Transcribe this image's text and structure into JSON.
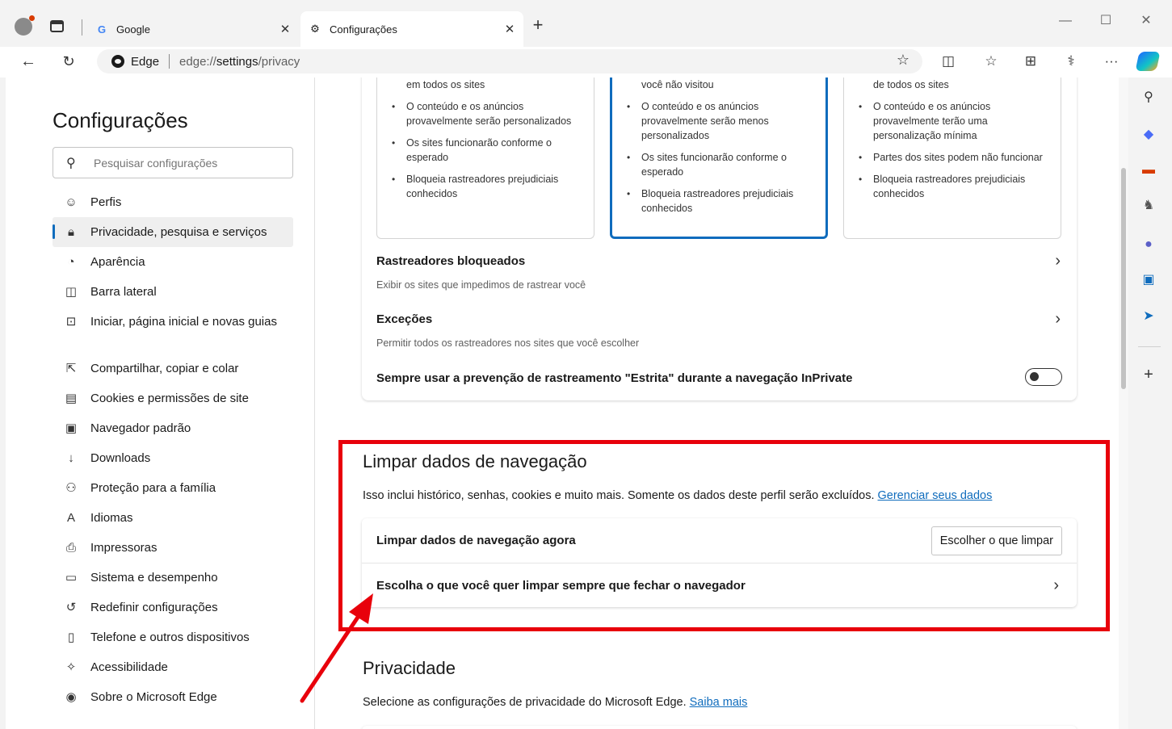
{
  "browser": {
    "tabs": [
      {
        "title": "Google",
        "icon": "google-icon"
      },
      {
        "title": "Configurações",
        "icon": "gear-icon"
      }
    ],
    "omnibox": {
      "brand": "Edge",
      "url_prefix": "edge://",
      "url_main": "settings",
      "url_suffix": "/privacy"
    }
  },
  "sidebar": {
    "title": "Configurações",
    "search_placeholder": "Pesquisar configurações",
    "items": [
      {
        "label": "Perfis",
        "icon": "profile-icon"
      },
      {
        "label": "Privacidade, pesquisa e serviços",
        "icon": "lock-icon",
        "active": true
      },
      {
        "label": "Aparência",
        "icon": "palette-icon"
      },
      {
        "label": "Barra lateral",
        "icon": "sidebar-icon"
      },
      {
        "label": "Iniciar, página inicial e novas guias",
        "icon": "home-icon"
      },
      {
        "label": "Compartilhar, copiar e colar",
        "icon": "share-icon"
      },
      {
        "label": "Cookies e permissões de site",
        "icon": "cookies-icon"
      },
      {
        "label": "Navegador padrão",
        "icon": "browser-icon"
      },
      {
        "label": "Downloads",
        "icon": "download-icon"
      },
      {
        "label": "Proteção para a família",
        "icon": "family-icon"
      },
      {
        "label": "Idiomas",
        "icon": "language-icon"
      },
      {
        "label": "Impressoras",
        "icon": "printer-icon"
      },
      {
        "label": "Sistema e desempenho",
        "icon": "laptop-icon"
      },
      {
        "label": "Redefinir configurações",
        "icon": "reset-icon"
      },
      {
        "label": "Telefone e outros dispositivos",
        "icon": "phone-icon"
      },
      {
        "label": "Acessibilidade",
        "icon": "accessibility-icon"
      },
      {
        "label": "Sobre o Microsoft Edge",
        "icon": "edge-icon"
      }
    ]
  },
  "tracking": {
    "cards": [
      {
        "items": [
          "em todos os sites",
          "O conteúdo e os anúncios provavelmente serão personalizados",
          "Os sites funcionarão conforme o esperado",
          "Bloqueia rastreadores prejudiciais conhecidos"
        ]
      },
      {
        "items": [
          "você não visitou",
          "O conteúdo e os anúncios provavelmente serão menos personalizados",
          "Os sites funcionarão conforme o esperado",
          "Bloqueia rastreadores prejudiciais conhecidos"
        ],
        "selected": true
      },
      {
        "items": [
          "de todos os sites",
          "O conteúdo e os anúncios provavelmente terão uma personalização mínima",
          "Partes dos sites podem não funcionar",
          "Bloqueia rastreadores prejudiciais conhecidos"
        ]
      }
    ],
    "blocked_title": "Rastreadores bloqueados",
    "blocked_sub": "Exibir os sites que impedimos de rastrear você",
    "exceptions_title": "Exceções",
    "exceptions_sub": "Permitir todos os rastreadores nos sites que você escolher",
    "strict_label": "Sempre usar a prevenção de rastreamento \"Estrita\" durante a navegação InPrivate",
    "strict_on": false
  },
  "clear_data": {
    "title": "Limpar dados de navegação",
    "description": "Isso inclui histórico, senhas, cookies e muito mais. Somente os dados deste perfil serão excluídos.",
    "link": "Gerenciar seus dados",
    "now_label": "Limpar dados de navegação agora",
    "now_button": "Escolher o que limpar",
    "on_close_label": "Escolha o que você quer limpar sempre que fechar o navegador"
  },
  "privacy": {
    "title": "Privacidade",
    "description": "Selecione as configurações de privacidade do Microsoft Edge.",
    "link": "Saiba mais"
  },
  "annotation": {
    "color": "#e8000b"
  },
  "accent": "#0f6cbd"
}
